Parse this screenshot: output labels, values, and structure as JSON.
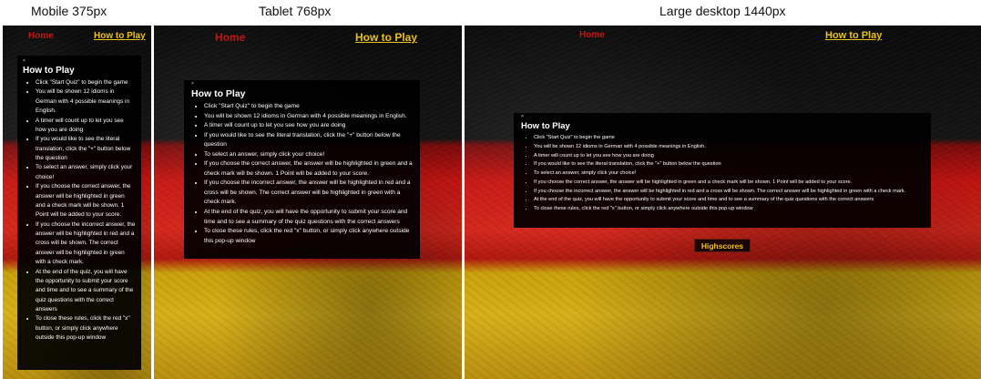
{
  "captions": {
    "mobile": "Mobile 375px",
    "tablet": "Tablet 768px",
    "desktop": "Large desktop 1440px"
  },
  "nav": {
    "home": "Home",
    "how_to_play": "How to Play"
  },
  "rules": {
    "close_mark": "×",
    "title": "How to Play",
    "items": [
      "Click \"Start Quiz\" to begin the game",
      "You will be shown 12 idioms in German with 4 possible meanings in English.",
      "A timer will count up to let you see how you are doing",
      "If you would like to see the literal translation, click the \"+\" button below the question",
      "To select an answer, simply click your choice!",
      "If you choose the correct answer, the answer will be highlighted in green and a check mark will be shown. 1 Point will be added to your score.",
      "If you choose the incorrect answer, the answer will be highlighted in red and a cross will be shown. The correct answer will be highlighted in green with a check mark.",
      "At the end of the quiz, you will have the opportunity to submit your score and time and to see a summary of the quiz questions with the correct answers",
      "To close these rules, click the red \"x\" button, or simply click anywhere outside this pop-up window"
    ]
  },
  "highscores_label": "Highscores",
  "colors": {
    "flag_black": "#0b0b0b",
    "flag_red": "#c81410",
    "flag_gold": "#d7b01a",
    "nav_home": "#c81410",
    "nav_howto": "#f0c419"
  }
}
